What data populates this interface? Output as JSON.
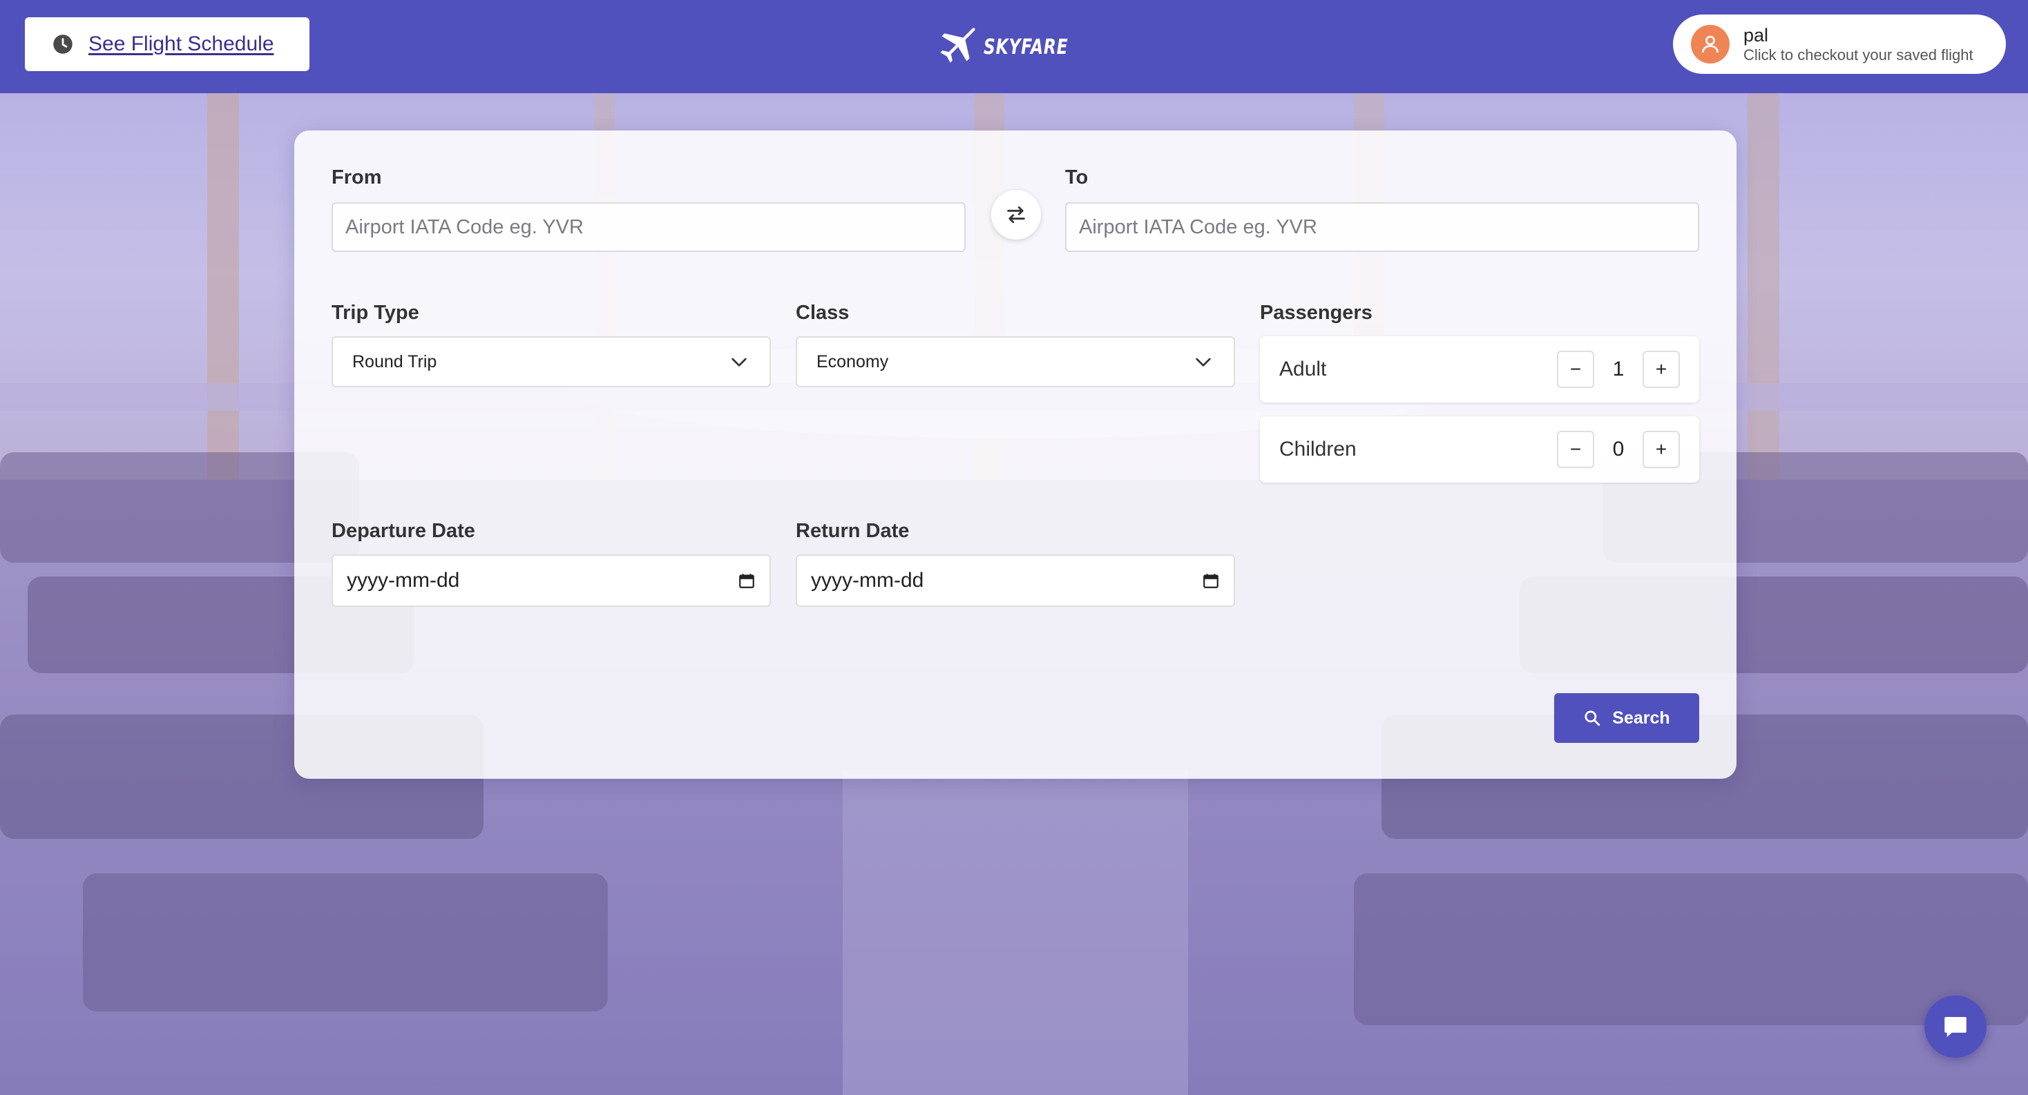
{
  "header": {
    "schedule_button": {
      "label": " See Flight Schedule",
      "icon": "clock-icon"
    },
    "logo": {
      "brand": "SKYFARE",
      "icon": "airplane-icon"
    },
    "user": {
      "name": "pal",
      "subtitle": "Click to checkout your saved flight",
      "avatar_icon": "user-icon",
      "avatar_color": "#ef8555"
    }
  },
  "search_form": {
    "from": {
      "label": "From",
      "placeholder": "Airport IATA Code eg. YVR",
      "value": ""
    },
    "to": {
      "label": "To",
      "placeholder": "Airport IATA Code eg. YVR",
      "value": ""
    },
    "swap_icon": "swap-arrows-icon",
    "trip_type": {
      "label": "Trip Type",
      "selected": "Round Trip"
    },
    "class": {
      "label": "Class",
      "selected": "Economy"
    },
    "passengers": {
      "label": "Passengers",
      "adult": {
        "label": "Adult",
        "count": "1",
        "decrement": "−",
        "increment": "+"
      },
      "children": {
        "label": "Children",
        "count": "0",
        "decrement": "−",
        "increment": "+"
      }
    },
    "departure_date": {
      "label": "Departure Date",
      "value": "yyyy-mm-dd"
    },
    "return_date": {
      "label": "Return Date",
      "value": "yyyy-mm-dd"
    },
    "search_button": {
      "label": "Search",
      "icon": "search-icon"
    }
  },
  "chat_button": {
    "icon": "chat-bubble-icon"
  },
  "colors": {
    "primary": "#5051bd",
    "link": "#3a2f8f",
    "avatar": "#ef8555"
  }
}
